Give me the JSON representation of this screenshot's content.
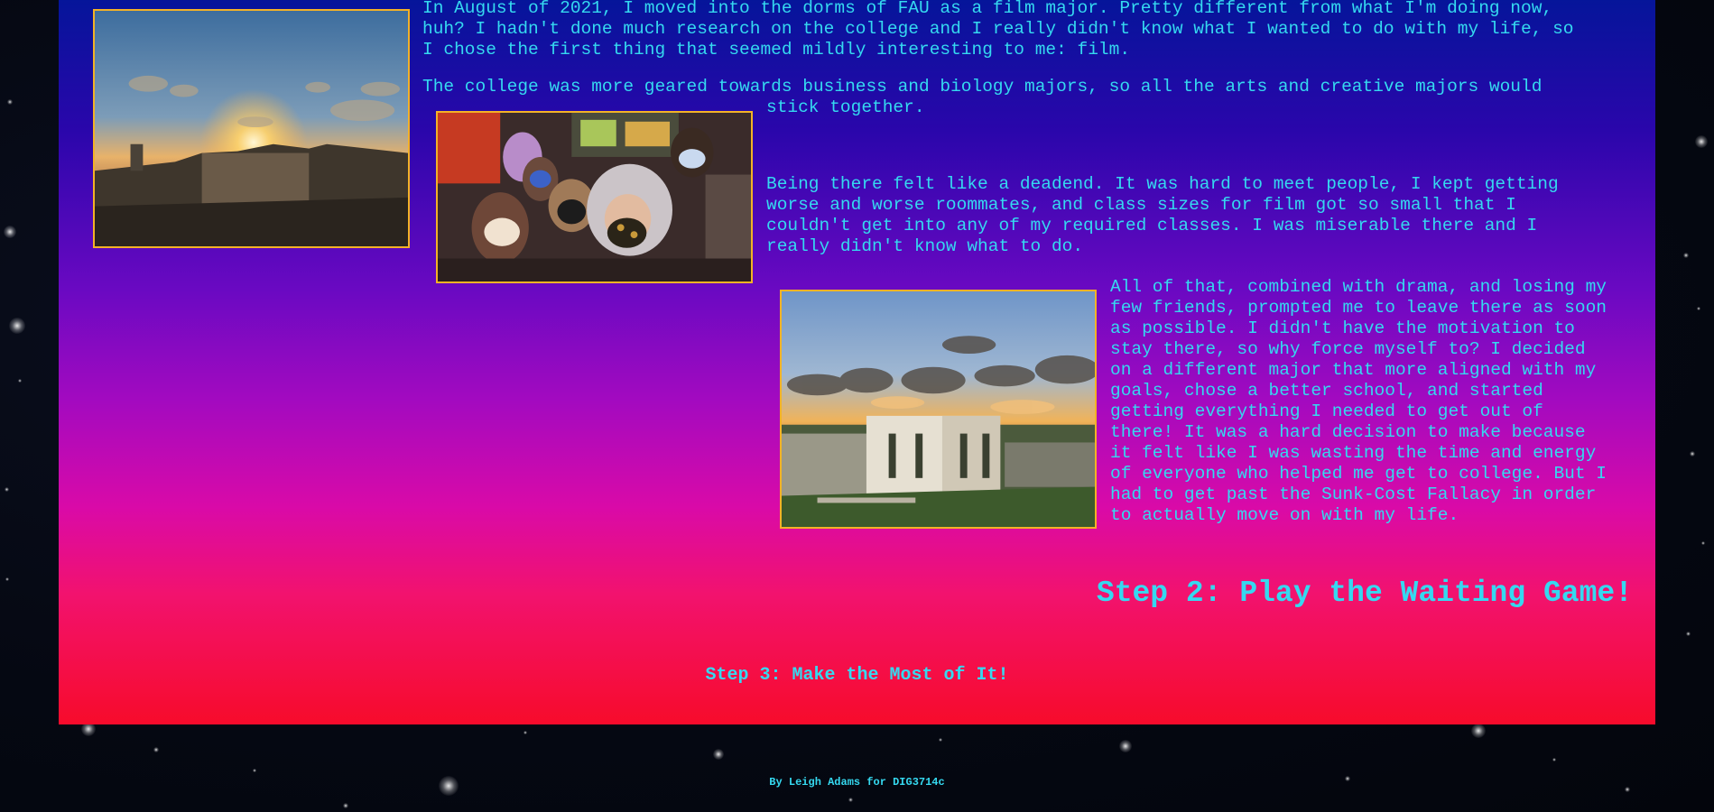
{
  "article": {
    "paragraph_1": "In August of 2021, I moved into the dorms of FAU as a film major. Pretty different from what I'm doing now,\nhuh? I hadn't done much research on the college and I really didn't know what I wanted to do with my life, so\nI chose the first thing that seemed mildly interesting to me: film.",
    "paragraph_2a": "The college was more geared towards business and biology majors, so all the arts and creative majors would",
    "paragraph_2b": "stick together.",
    "paragraph_3": "Being there felt like a deadend. It was hard to meet people, I kept getting\nworse and worse roommates, and class sizes for film got so small that I\ncouldn't get into any of my required classes. I was miserable there and I\nreally didn't know what to do.",
    "paragraph_4": "All of that, combined with drama, and losing my\nfew friends, prompted me to leave there as soon\nas possible. I didn't have the motivation to\nstay there, so why force myself to? I decided\non a different major that more aligned with my\ngoals, chose a better school, and started\ngetting everything I needed to get out of\nthere! It was a hard decision to make because\nit felt like I was wasting the time and energy\nof everyone who helped me get to college. But I\nhad to get past the Sunk-Cost Fallacy in order\nto actually move on with my life."
  },
  "headings": {
    "step_2": "Step 2: Play the Waiting Game!",
    "step_3": "Step 3: Make the Most of It!"
  },
  "footer": {
    "credit": "By Leigh Adams for DIG3714c"
  },
  "colors": {
    "text": "#35d9f0",
    "photo_border": "#f3b227",
    "gradient_top": "#05159a",
    "gradient_bottom": "#f70b2b"
  }
}
